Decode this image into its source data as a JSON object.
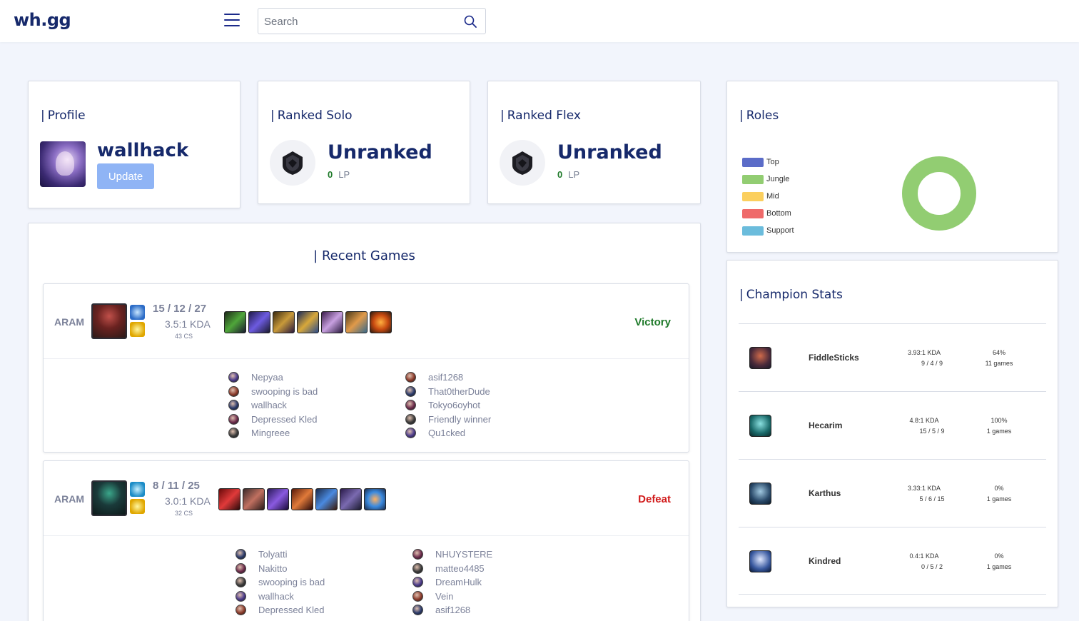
{
  "header": {
    "logo": "wh.gg",
    "search_placeholder": "Search"
  },
  "profile": {
    "title": "Profile",
    "username": "wallhack",
    "update_label": "Update"
  },
  "ranked_solo": {
    "title": "Ranked Solo",
    "rank": "Unranked",
    "lp": "0",
    "lp_label": "LP"
  },
  "ranked_flex": {
    "title": "Ranked Flex",
    "rank": "Unranked",
    "lp": "0",
    "lp_label": "LP"
  },
  "roles": {
    "title": "Roles",
    "legend": [
      {
        "label": "Top",
        "color": "#5b6cc8"
      },
      {
        "label": "Jungle",
        "color": "#92cd72"
      },
      {
        "label": "Mid",
        "color": "#fbcf5e"
      },
      {
        "label": "Bottom",
        "color": "#ef6a6a"
      },
      {
        "label": "Support",
        "color": "#6bbcdc"
      }
    ]
  },
  "chart_data": {
    "type": "pie",
    "categories": [
      "Top",
      "Jungle",
      "Mid",
      "Bottom",
      "Support"
    ],
    "values": [
      0,
      100,
      0,
      0,
      0
    ]
  },
  "recent_games": {
    "title": "Recent Games",
    "games": [
      {
        "mode": "ARAM",
        "kda": "15 / 12 / 27",
        "ratio": "3.5:1 KDA",
        "cs": "43 CS",
        "result": "Victory",
        "result_color": "#1f7a2a",
        "team1": [
          "Nepyaa",
          "swooping is bad",
          "wallhack",
          "Depressed Kled",
          "Mingreee"
        ],
        "team2": [
          "asif1268",
          "That0therDude",
          "Tokyo6oyhot",
          "Friendly winner",
          "Qu1cked"
        ]
      },
      {
        "mode": "ARAM",
        "kda": "8 / 11 / 25",
        "ratio": "3.0:1 KDA",
        "cs": "32 CS",
        "result": "Defeat",
        "result_color": "#d11a1a",
        "team1": [
          "Tolyatti",
          "Nakitto",
          "swooping is bad",
          "wallhack",
          "Depressed Kled"
        ],
        "team2": [
          "NHUYSTERE",
          "matteo4485",
          "DreamHulk",
          "Vein",
          "asif1268"
        ]
      }
    ]
  },
  "champion_stats": {
    "title": "Champion Stats",
    "rows": [
      {
        "name": "FiddleSticks",
        "kda_ratio": "3.93:1 KDA",
        "kda": "9 / 4 / 9",
        "winrate": "64%",
        "games": "11 games"
      },
      {
        "name": "Hecarim",
        "kda_ratio": "4.8:1 KDA",
        "kda": "15 / 5 / 9",
        "winrate": "100%",
        "games": "1 games"
      },
      {
        "name": "Karthus",
        "kda_ratio": "3.33:1 KDA",
        "kda": "5 / 6 / 15",
        "winrate": "0%",
        "games": "1 games"
      },
      {
        "name": "Kindred",
        "kda_ratio": "0.4:1 KDA",
        "kda": "0 / 5 / 2",
        "winrate": "0%",
        "games": "1 games"
      }
    ]
  }
}
